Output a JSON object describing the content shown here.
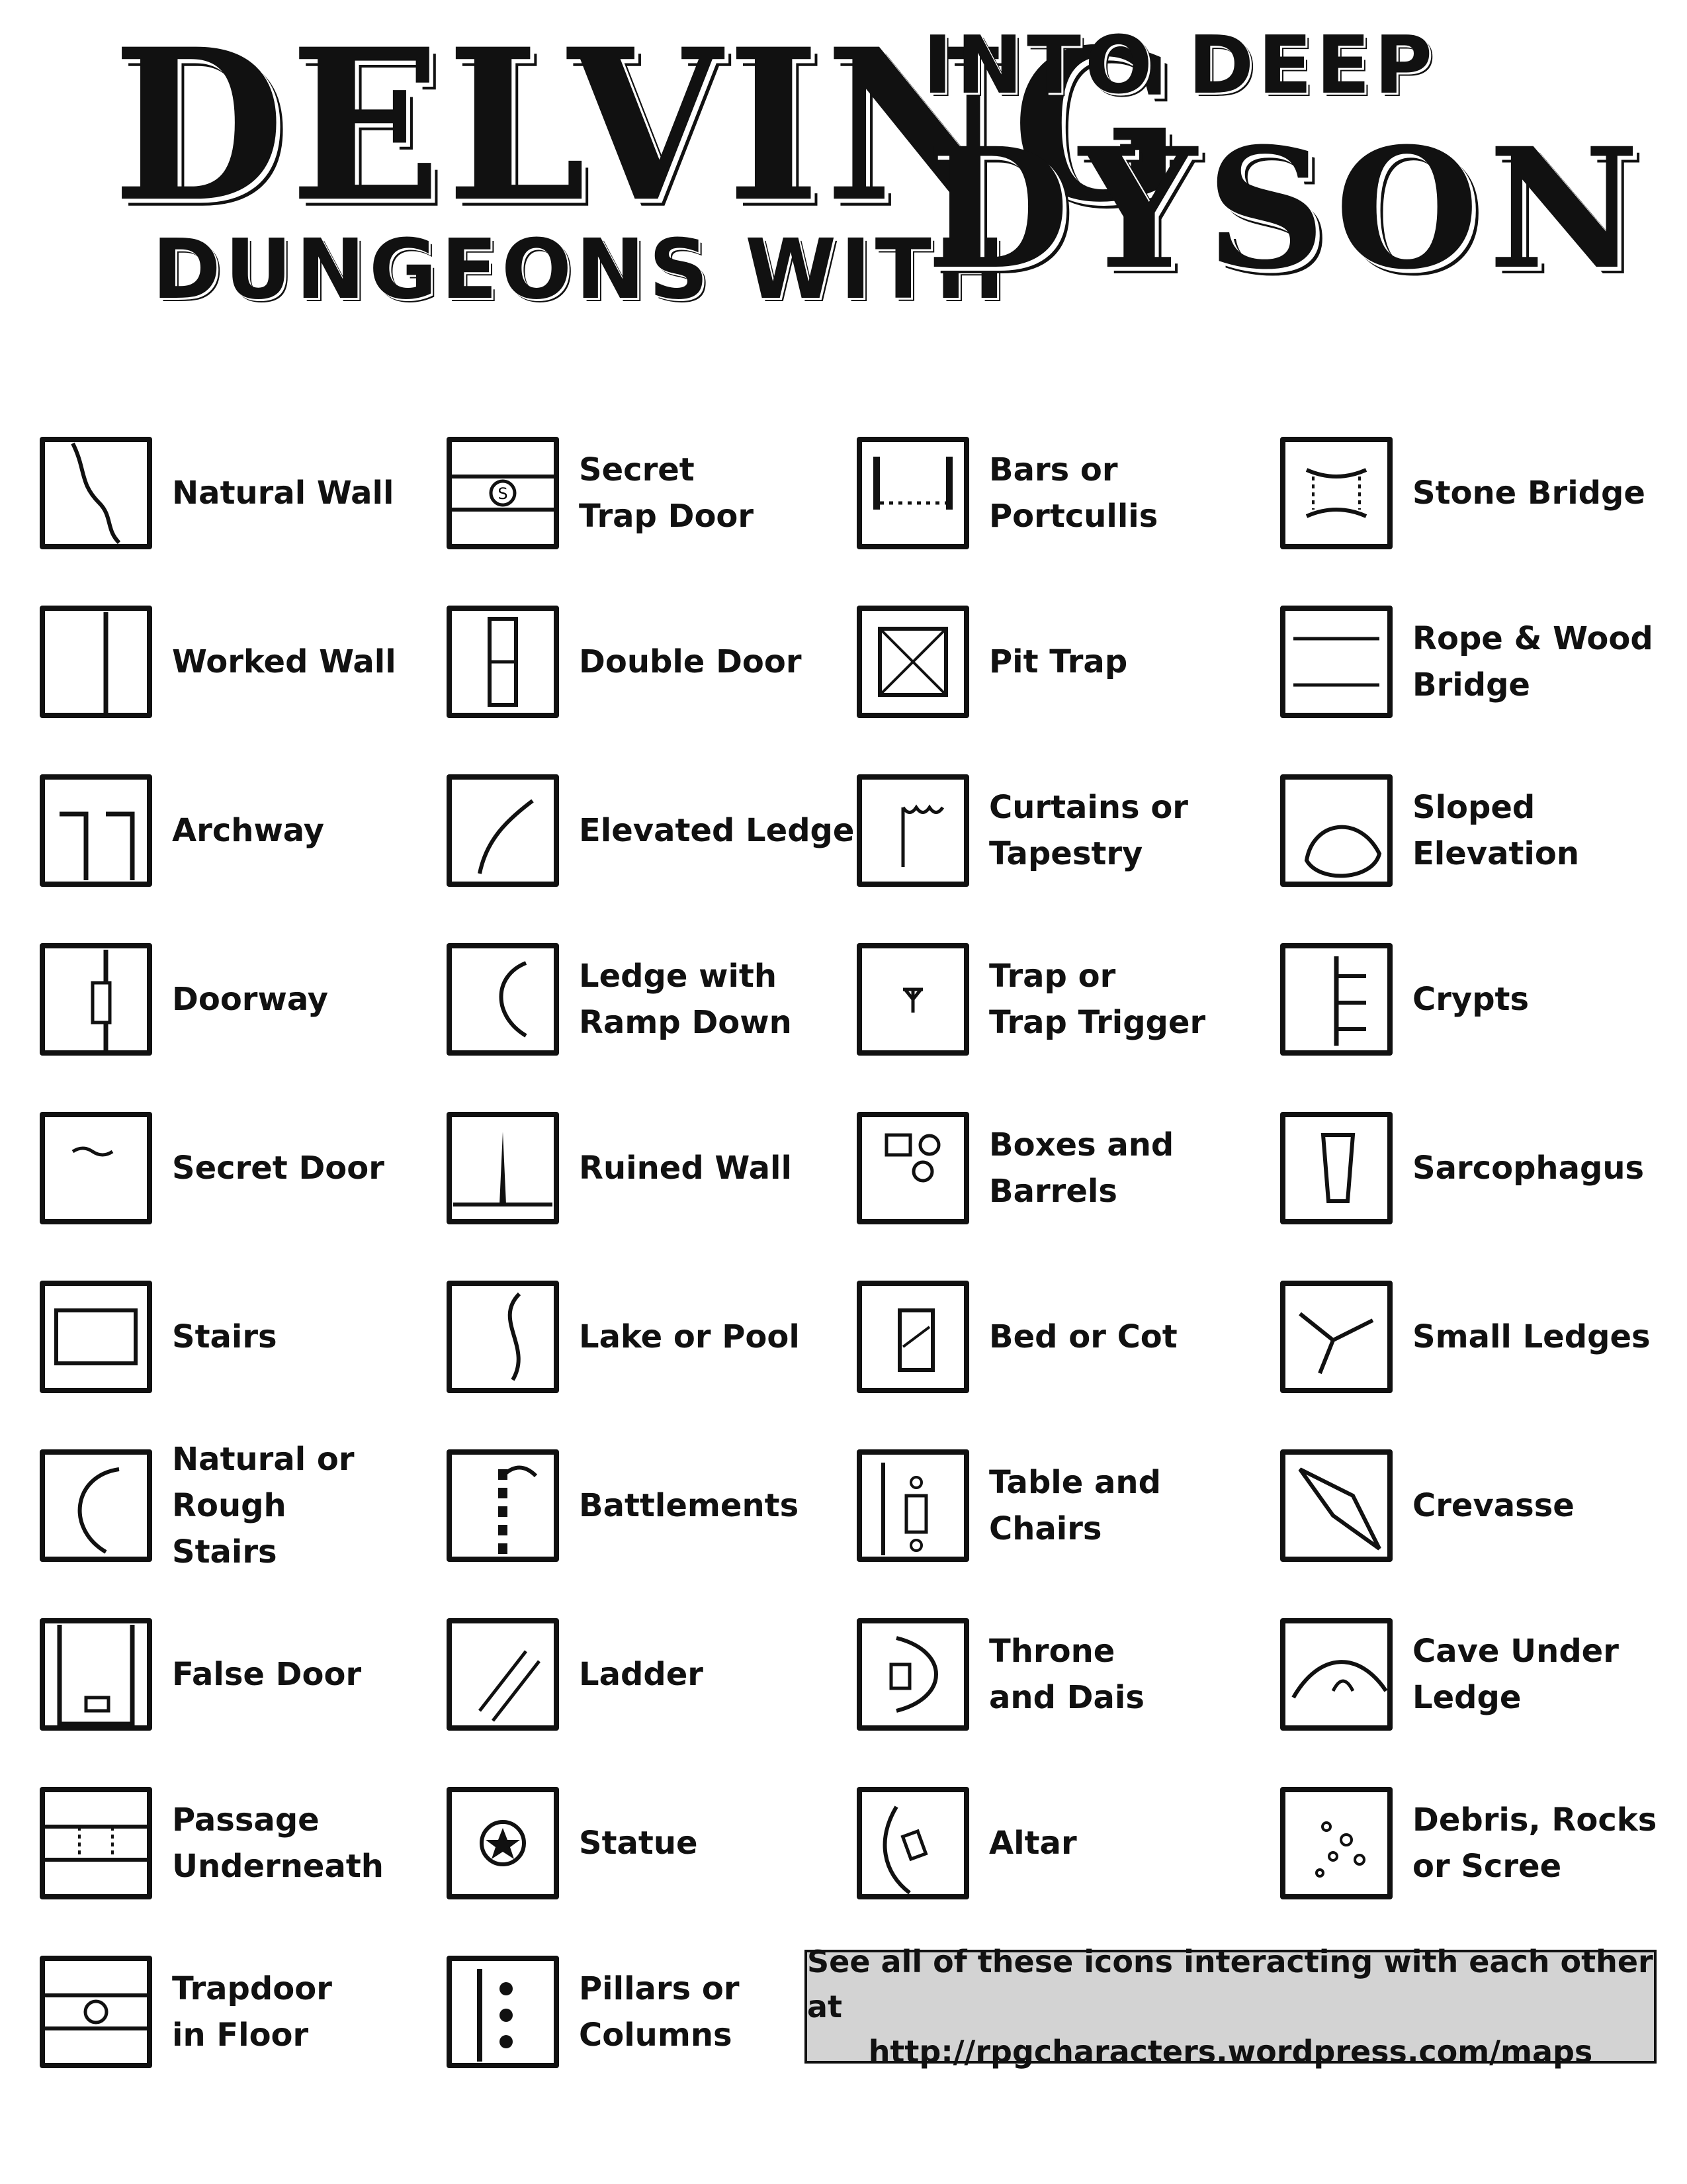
{
  "title": {
    "line1": "DELVING",
    "line2": "INTO DEEP",
    "line3": "DUNGEONS WITH",
    "line4": "DYSON"
  },
  "legend": [
    {
      "label": "Natural Wall",
      "icon": "natural-wall"
    },
    {
      "label": "Secret\nTrap Door",
      "icon": "secret-trap-door"
    },
    {
      "label": "Bars or\nPortcullis",
      "icon": "bars"
    },
    {
      "label": "Stone Bridge",
      "icon": "stone-bridge"
    },
    {
      "label": "Worked Wall",
      "icon": "worked-wall"
    },
    {
      "label": "Double Door",
      "icon": "double-door"
    },
    {
      "label": "Pit Trap",
      "icon": "pit-trap"
    },
    {
      "label": "Rope & Wood\nBridge",
      "icon": "rope-bridge"
    },
    {
      "label": "Archway",
      "icon": "archway"
    },
    {
      "label": "Elevated Ledge",
      "icon": "elevated-ledge"
    },
    {
      "label": "Curtains or\nTapestry",
      "icon": "curtains"
    },
    {
      "label": "Sloped Elevation",
      "icon": "sloped-elevation"
    },
    {
      "label": "Doorway",
      "icon": "doorway"
    },
    {
      "label": "Ledge with\nRamp Down",
      "icon": "ledge-ramp"
    },
    {
      "label": "Trap or\nTrap Trigger",
      "icon": "trap-trigger"
    },
    {
      "label": "Crypts",
      "icon": "crypts"
    },
    {
      "label": "Secret Door",
      "icon": "secret-door"
    },
    {
      "label": "Ruined Wall",
      "icon": "ruined-wall"
    },
    {
      "label": "Boxes and\nBarrels",
      "icon": "boxes-barrels"
    },
    {
      "label": "Sarcophagus",
      "icon": "sarcophagus"
    },
    {
      "label": "Stairs",
      "icon": "stairs"
    },
    {
      "label": "Lake or Pool",
      "icon": "lake-pool"
    },
    {
      "label": "Bed or Cot",
      "icon": "bed"
    },
    {
      "label": "Small Ledges",
      "icon": "small-ledges"
    },
    {
      "label": "Natural or Rough\nStairs",
      "icon": "rough-stairs"
    },
    {
      "label": "Battlements",
      "icon": "battlements"
    },
    {
      "label": "Table and\nChairs",
      "icon": "table-chairs"
    },
    {
      "label": "Crevasse",
      "icon": "crevasse"
    },
    {
      "label": "False Door",
      "icon": "false-door"
    },
    {
      "label": "Ladder",
      "icon": "ladder"
    },
    {
      "label": "Throne\nand Dais",
      "icon": "throne"
    },
    {
      "label": "Cave Under\nLedge",
      "icon": "cave-ledge"
    },
    {
      "label": "Passage\nUnderneath",
      "icon": "passage-underneath"
    },
    {
      "label": "Statue",
      "icon": "statue"
    },
    {
      "label": "Altar",
      "icon": "altar"
    },
    {
      "label": "Debris, Rocks\nor Scree",
      "icon": "debris"
    },
    {
      "label": "Trapdoor\nin Floor",
      "icon": "trapdoor"
    },
    {
      "label": "Pillars or\nColumns",
      "icon": "pillars"
    }
  ],
  "note": {
    "line1": "See all of these icons interacting with each other at",
    "line2": "http://rpgcharacters.wordpress.com/maps"
  }
}
